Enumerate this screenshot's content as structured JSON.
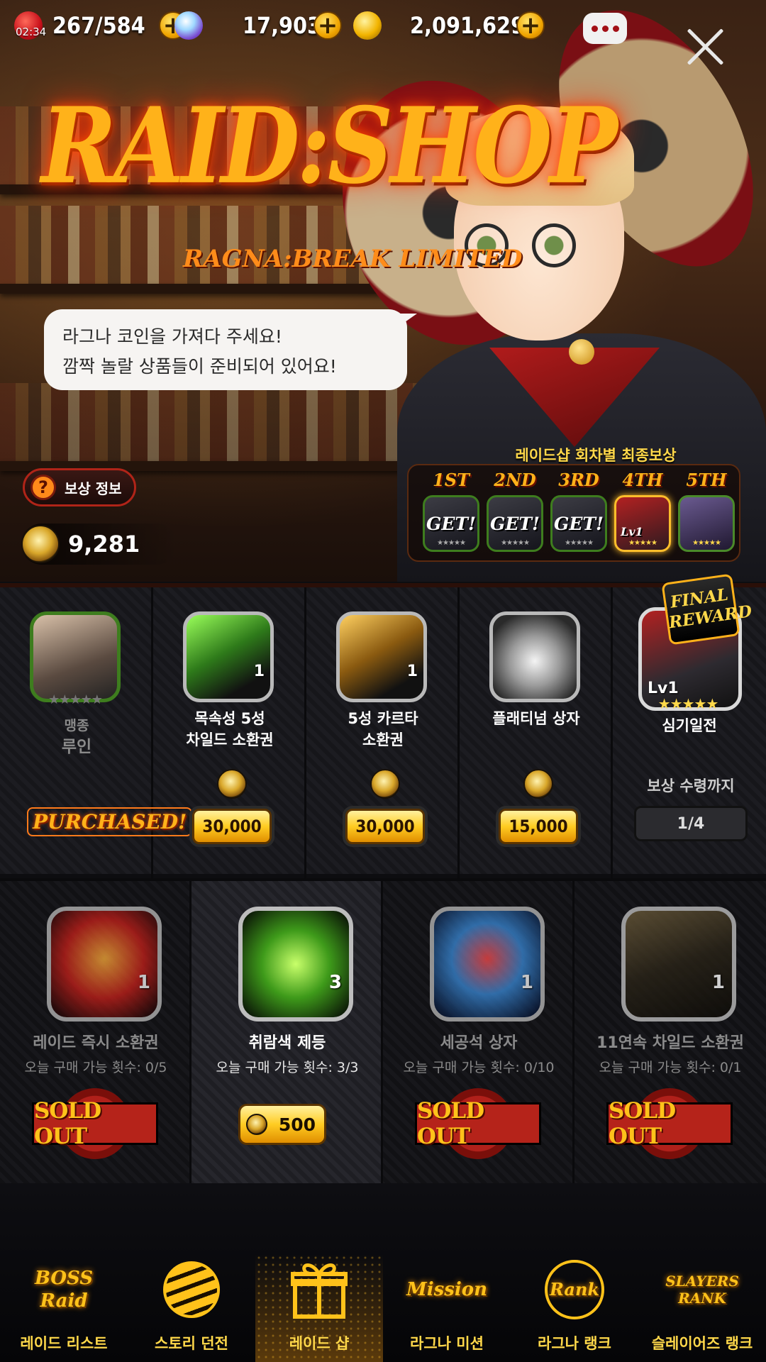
{
  "status_bar": {
    "time": "02:34",
    "stamina": "267/584",
    "gems": "17,903",
    "gold": "2,091,629",
    "plus_symbol": "+"
  },
  "hero": {
    "title": "RAID:SHOP",
    "subtitle": "RAGNA:BREAK LIMITED",
    "speech_line1": "라그나 코인을 가져다 주세요!",
    "speech_line2": "깜짝 놀랄 상품들이 준비되어 있어요!",
    "reward_info_label": "보상 정보",
    "help_symbol": "?",
    "coin_balance": "9,281",
    "rounds_title": "레이드샵 회차별 최종보상",
    "rounds": [
      {
        "ordinal": "1ST",
        "state": "GET!"
      },
      {
        "ordinal": "2ND",
        "state": "GET!"
      },
      {
        "ordinal": "3RD",
        "state": "GET!"
      },
      {
        "ordinal": "4TH",
        "state": "Lv1"
      },
      {
        "ordinal": "5TH",
        "state": ""
      }
    ]
  },
  "row1": [
    {
      "grade": "맹종",
      "name": "루인",
      "status": "PURCHASED!",
      "stars": "★★★★★"
    },
    {
      "line1": "목속성 5성",
      "line2": "차일드 소환권",
      "qty": "1",
      "price": "30,000"
    },
    {
      "line1": "5성 카르타",
      "line2": "소환권",
      "qty": "1",
      "price": "30,000"
    },
    {
      "line1": "플래티넘 상자",
      "line2": "",
      "price": "15,000"
    },
    {
      "badge": "FINAL REWARD",
      "level": "Lv1",
      "stars": "★★★★★",
      "name": "심기일전",
      "until_label": "보상 수령까지",
      "progress": "1/4",
      "progress_value": 0.25
    }
  ],
  "row2": [
    {
      "name": "레이드 즉시 소환권",
      "limit": "오늘 구매 가능 횟수: 0/5",
      "qty": "1",
      "status": "SOLD OUT"
    },
    {
      "name": "취람색 제등",
      "limit": "오늘 구매 가능 횟수: 3/3",
      "qty": "3",
      "price": "500"
    },
    {
      "name": "세공석 상자",
      "limit": "오늘 구매 가능 횟수: 0/10",
      "qty": "1",
      "status": "SOLD OUT"
    },
    {
      "name": "11연속 차일드 소환권",
      "limit": "오늘 구매 가능 횟수: 0/1",
      "qty": "1",
      "status": "SOLD OUT"
    }
  ],
  "nav": [
    {
      "logo": "BOSS Raid",
      "label": "레이드 리스트"
    },
    {
      "logo": "",
      "label": "스토리 던전"
    },
    {
      "logo": "",
      "label": "레이드 샵"
    },
    {
      "logo": "Mission",
      "label": "라그나 미션"
    },
    {
      "logo": "Rank",
      "label": "라그나 랭크"
    },
    {
      "logo": "SLAYERS RANK",
      "label": "슬레이어즈 랭크"
    }
  ],
  "colors": {
    "accent": "#ffc21a",
    "sold_out": "#b5231a",
    "price_button": "#ffcc22"
  }
}
